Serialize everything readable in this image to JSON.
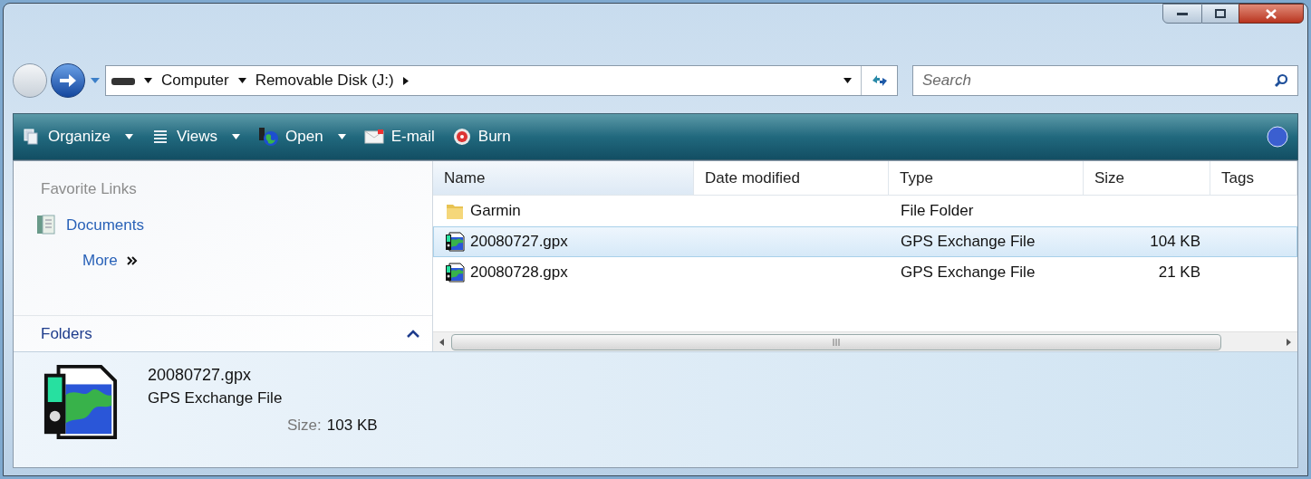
{
  "address_bar": {
    "breadcrumbs": [
      "Computer",
      "Removable Disk (J:)"
    ]
  },
  "search": {
    "placeholder": "Search"
  },
  "toolbar": {
    "buttons": [
      {
        "label": "Organize",
        "kind": "organize",
        "dropdown": true
      },
      {
        "label": "Views",
        "kind": "views",
        "dropdown": true
      },
      {
        "label": "Open",
        "kind": "open",
        "dropdown": true
      },
      {
        "label": "E-mail",
        "kind": "email",
        "dropdown": false
      },
      {
        "label": "Burn",
        "kind": "burn",
        "dropdown": false
      }
    ]
  },
  "navigation_pane": {
    "favorite_links_heading": "Favorite Links",
    "links": [
      "Documents"
    ],
    "more": "More",
    "folders": "Folders",
    "folders_expanded": false
  },
  "table": {
    "columns": [
      "Name",
      "Date modified",
      "Type",
      "Size",
      "Tags"
    ],
    "rows": [
      {
        "name": "Garmin",
        "kind": "folder",
        "type": "File Folder",
        "size": "",
        "selected": false
      },
      {
        "name": "20080727.gpx",
        "kind": "gpx",
        "type": "GPS Exchange File",
        "size": "104 KB",
        "selected": true
      },
      {
        "name": "20080728.gpx",
        "kind": "gpx",
        "type": "GPS Exchange File",
        "size": "21 KB",
        "selected": false
      }
    ]
  },
  "details_pane": {
    "name": "20080727.gpx",
    "type": "GPS Exchange File",
    "size_label": "Size:",
    "size": "103 KB"
  }
}
